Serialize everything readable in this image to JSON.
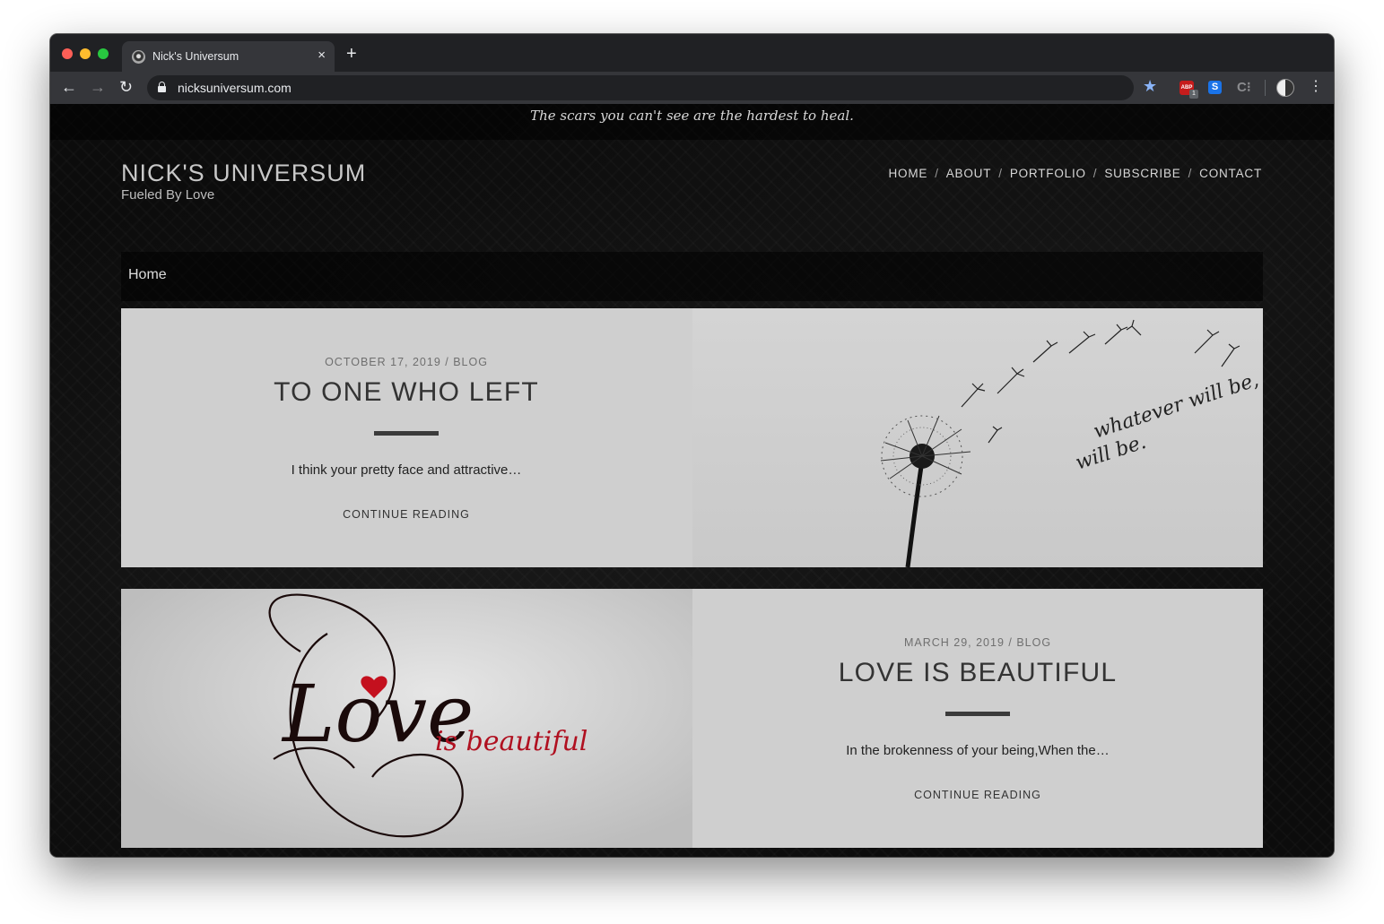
{
  "browser": {
    "tab_title": "Nick's Universum",
    "tab_close": "×",
    "new_tab": "+",
    "url": "nicksuniversum.com",
    "extensions": {
      "abp_label": "ABP",
      "abp_badge": "1",
      "s_label": "S",
      "c_label": "C⁝"
    }
  },
  "site": {
    "quote": "The scars you can't see are the hardest to heal.",
    "title": "NICK'S UNIVERSUM",
    "tagline": "Fueled By Love",
    "nav": [
      "HOME",
      "ABOUT",
      "PORTFOLIO",
      "SUBSCRIBE",
      "CONTACT"
    ],
    "nav_separator": "/",
    "breadcrumb": "Home"
  },
  "posts": [
    {
      "meta": "OCTOBER 17, 2019 / BLOG",
      "title": "TO ONE WHO LEFT",
      "excerpt": "I think your pretty face and attractive…",
      "cta": "CONTINUE READING",
      "image_text": [
        "whatever will be,",
        "will be."
      ]
    },
    {
      "meta": "MARCH 29, 2019 / BLOG",
      "title": "LOVE IS BEAUTIFUL",
      "excerpt": "In the brokenness of your being,When the…",
      "cta": "CONTINUE READING",
      "image_text": [
        "Love",
        "is beautiful"
      ]
    }
  ],
  "colors": {
    "page_bg": "#0c0c0c",
    "card_bg": "#cfcfcf",
    "accent_red": "#b01020",
    "bookmark_star": "#8ab4f8"
  }
}
